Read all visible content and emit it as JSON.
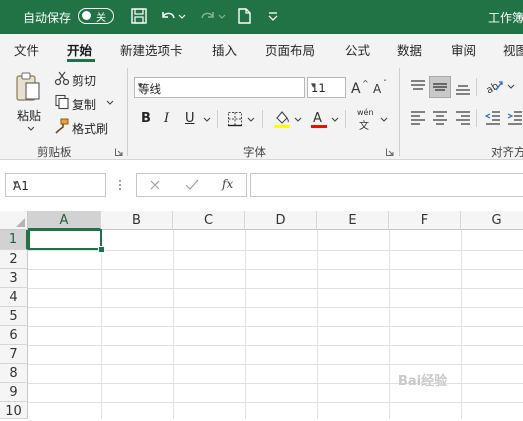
{
  "titlebar": {
    "autosave_label": "自动保存",
    "autosave_state": "关",
    "doc_title": "工作簿",
    "bg_color": "#217346"
  },
  "tabs": [
    "文件",
    "开始",
    "新建选项卡",
    "插入",
    "页面布局",
    "公式",
    "数据",
    "审阅",
    "视图"
  ],
  "active_tab": "开始",
  "clipboard": {
    "paste_label": "粘贴",
    "cut_label": "剪切",
    "copy_label": "复制",
    "format_painter_label": "格式刷",
    "group_label": "剪贴板"
  },
  "font": {
    "font_name": "等线",
    "font_size": "11",
    "bold": "B",
    "italic": "I",
    "underline": "U",
    "phonetic": "wén",
    "phonetic_sub": "文",
    "group_label": "字体",
    "highlight_color": "#ffff00",
    "font_color": "#e51400"
  },
  "alignment": {
    "group_label": "对齐方"
  },
  "formula_bar": {
    "name_box": "A1",
    "fx": "fx",
    "formula": ""
  },
  "grid": {
    "columns": [
      "A",
      "B",
      "C",
      "D",
      "E",
      "F",
      "G"
    ],
    "rows": [
      "1",
      "2",
      "3",
      "4",
      "5",
      "6",
      "7",
      "8",
      "9",
      "10"
    ],
    "selected_cell": "A1",
    "accent_color": "#217346"
  },
  "watermark": "Bai经验"
}
